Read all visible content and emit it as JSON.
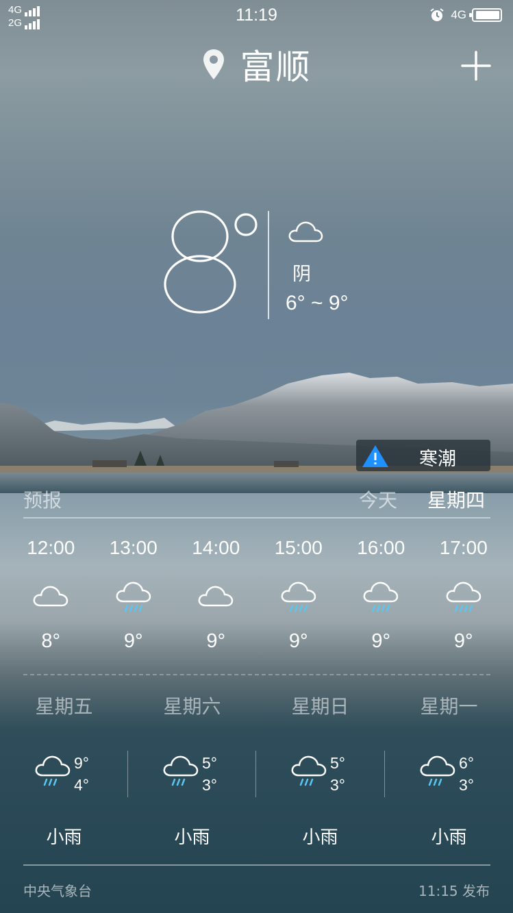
{
  "status_bar": {
    "net_top": "4G",
    "net_bottom": "2G",
    "time": "11:19",
    "net_right": "4G",
    "alarm_icon": "alarm-clock-icon",
    "battery_icon": "battery-icon"
  },
  "header": {
    "location_icon": "location-pin-icon",
    "city": "富顺",
    "add_icon": "plus-icon"
  },
  "current": {
    "temperature": "8",
    "degree_symbol": "°",
    "condition_icon": "cloud-icon",
    "condition": "阴",
    "range": "6° ~ 9°"
  },
  "alert": {
    "icon": "warning-triangle-icon",
    "text": "寒潮"
  },
  "forecast": {
    "label": "预报",
    "today": "今天",
    "selected_day": "星期四",
    "hourly": [
      {
        "time": "12:00",
        "icon": "cloud-icon",
        "temp": "8°"
      },
      {
        "time": "13:00",
        "icon": "rain-cloud-icon",
        "temp": "9°"
      },
      {
        "time": "14:00",
        "icon": "cloud-icon",
        "temp": "9°"
      },
      {
        "time": "15:00",
        "icon": "rain-cloud-icon",
        "temp": "9°"
      },
      {
        "time": "16:00",
        "icon": "rain-cloud-icon",
        "temp": "9°"
      },
      {
        "time": "17:00",
        "icon": "rain-cloud-icon",
        "temp": "9°"
      }
    ],
    "daily": [
      {
        "day": "星期五",
        "icon": "rain-cloud-icon",
        "high": "9°",
        "low": "4°",
        "condition": "小雨"
      },
      {
        "day": "星期六",
        "icon": "rain-cloud-icon",
        "high": "5°",
        "low": "3°",
        "condition": "小雨"
      },
      {
        "day": "星期日",
        "icon": "rain-cloud-icon",
        "high": "5°",
        "low": "3°",
        "condition": "小雨"
      },
      {
        "day": "星期一",
        "icon": "rain-cloud-icon",
        "high": "6°",
        "low": "3°",
        "condition": "小雨"
      }
    ]
  },
  "footer": {
    "source": "中央气象台",
    "published": "11:15 发布"
  },
  "colors": {
    "rain_drop": "#5bc6f0",
    "alert_triangle": "#1e90ff"
  }
}
